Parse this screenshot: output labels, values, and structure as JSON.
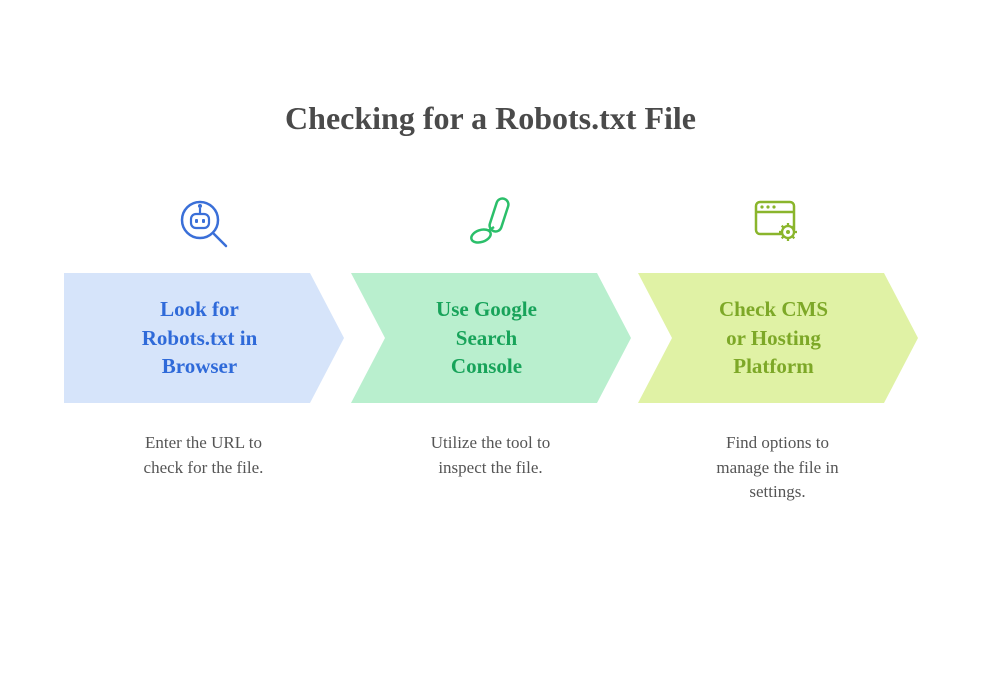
{
  "title": "Checking for a Robots.txt File",
  "steps": [
    {
      "icon": "robot-search",
      "label_l1": "Look for",
      "label_l2": "Robots.txt in",
      "label_l3": "Browser",
      "desc_l1": "Enter the URL to",
      "desc_l2": "check for the file.",
      "desc_l3": "",
      "fill": "#d6e4fa",
      "stroke": "#3a6fd8"
    },
    {
      "icon": "paint-roller",
      "label_l1": "Use Google",
      "label_l2": "Search",
      "label_l3": "Console",
      "desc_l1": "Utilize the tool to",
      "desc_l2": "inspect the file.",
      "desc_l3": "",
      "fill": "#b9efce",
      "stroke": "#2bbf6a"
    },
    {
      "icon": "browser-gear",
      "label_l1": "Check CMS",
      "label_l2": "or Hosting",
      "label_l3": "Platform",
      "desc_l1": "Find options to",
      "desc_l2": "manage the file in",
      "desc_l3": "settings.",
      "fill": "#e0f2a5",
      "stroke": "#8ab52c"
    }
  ]
}
